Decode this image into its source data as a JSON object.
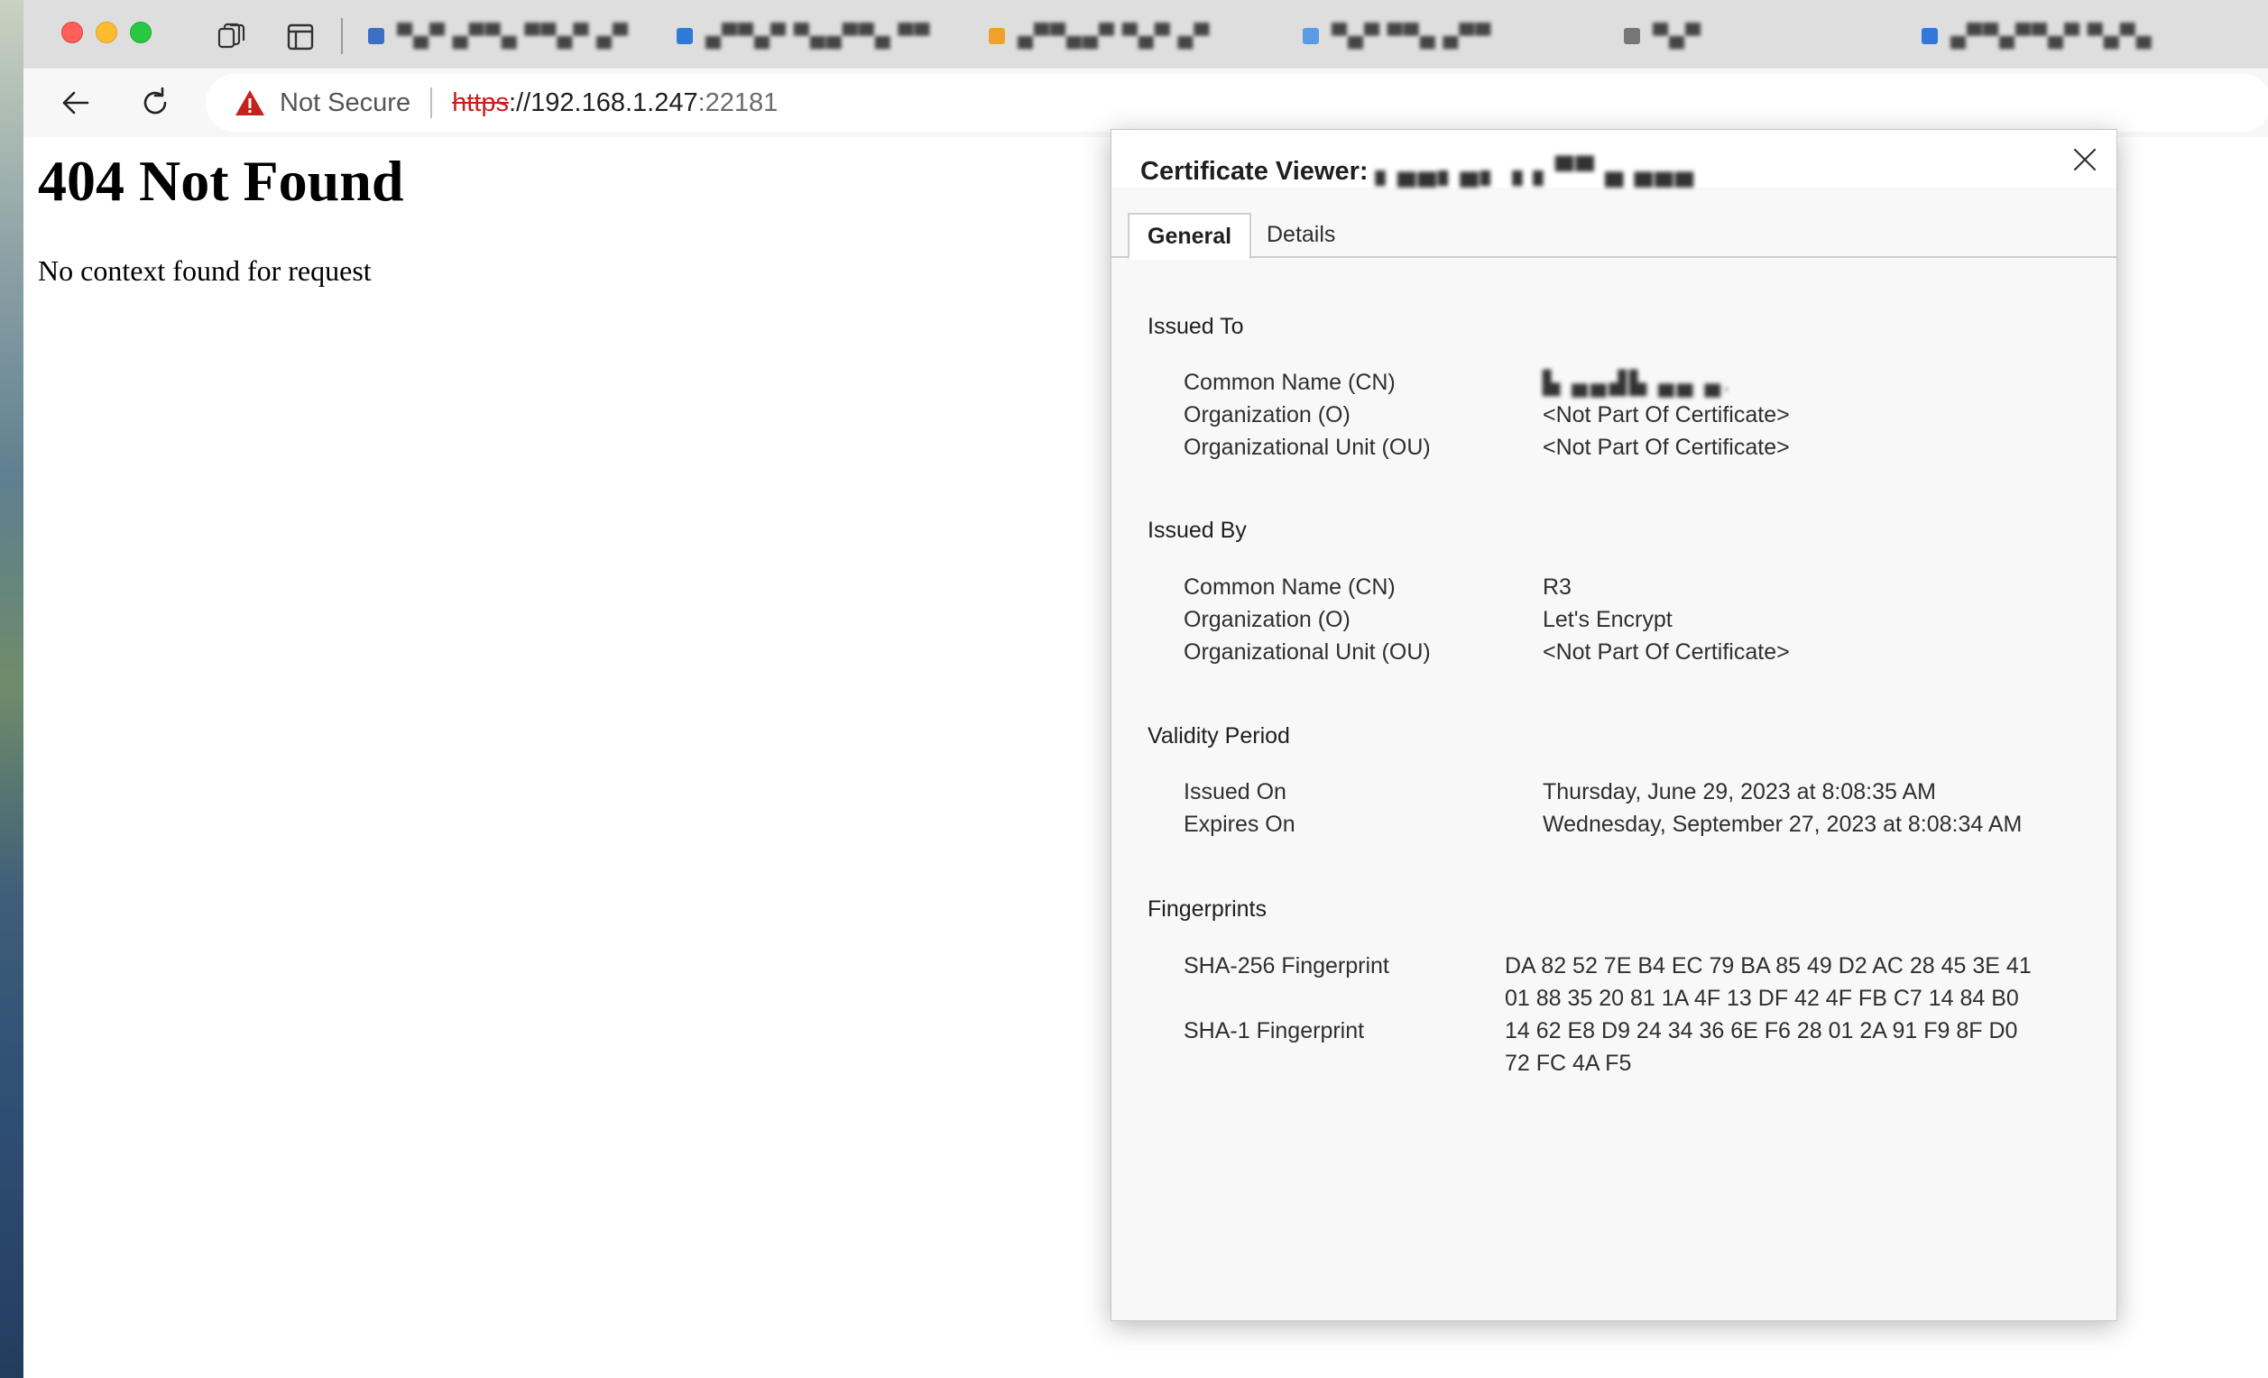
{
  "browser": {
    "tabs": [
      {
        "title": "▀▄▀ ▄▀▀▄ ▀▀▄▀ ▄▀",
        "favicon_color": "#3b6fc4"
      },
      {
        "title": "▄▀▀▄▀ ▀▄▄▀▀▄ ▀▀",
        "favicon_color": "#2f7ad8"
      },
      {
        "title": "▄▀▀▄▄▀ ▀▄▀ ▄▀",
        "favicon_color": "#f0a12b"
      },
      {
        "title": "▀▄▀ ▀▀▄ ▄▀▀",
        "favicon_color": "#5a9be6"
      },
      {
        "title": "▀▄▀",
        "favicon_color": "#777777"
      },
      {
        "title": "▄▀▀▄▀▀▄▀ ▀▄▀▄",
        "favicon_color": "#2f7ad8"
      }
    ],
    "address": {
      "security_label": "Not Secure",
      "scheme": "https",
      "separator": "://",
      "host": "192.168.1.247",
      "port": ":22181"
    }
  },
  "page": {
    "heading": "404 Not Found",
    "message": "No context found for request"
  },
  "certificate_viewer": {
    "title": "Certificate Viewer:",
    "subject": "▖▄▄▖▄▖▗ ▖▀▀ ▄ ▄▄▄",
    "tabs": [
      "General",
      "Details"
    ],
    "issued_to": {
      "heading": "Issued To",
      "rows": [
        {
          "label": "Common Name (CN)",
          "value": "▙ ▄▄▟▙ ▄▄ ▄."
        },
        {
          "label": "Organization (O)",
          "value": "<Not Part Of Certificate>"
        },
        {
          "label": "Organizational Unit (OU)",
          "value": "<Not Part Of Certificate>"
        }
      ]
    },
    "issued_by": {
      "heading": "Issued By",
      "rows": [
        {
          "label": "Common Name (CN)",
          "value": "R3"
        },
        {
          "label": "Organization (O)",
          "value": "Let's Encrypt"
        },
        {
          "label": "Organizational Unit (OU)",
          "value": "<Not Part Of Certificate>"
        }
      ]
    },
    "validity": {
      "heading": "Validity Period",
      "rows": [
        {
          "label": "Issued On",
          "value": "Thursday, June 29, 2023 at 8:08:35 AM"
        },
        {
          "label": "Expires On",
          "value": "Wednesday, September 27, 2023 at 8:08:34 AM"
        }
      ]
    },
    "fingerprints": {
      "heading": "Fingerprints",
      "sha256_label": "SHA-256 Fingerprint",
      "sha256_line1": "DA 82 52 7E B4 EC 79 BA 85 49 D2 AC 28 45 3E 41",
      "sha256_line2": "01 88 35 20 81 1A 4F 13 DF 42 4F FB C7 14 84 B0",
      "sha1_label": "SHA-1 Fingerprint",
      "sha1_line1": "14 62 E8 D9 24 34 36 6E F6 28 01 2A 91 F9 8F D0",
      "sha1_line2": "72 FC 4A F5"
    }
  },
  "colors": {
    "insecure_red": "#c5221f",
    "tab_strip": "#dedede",
    "dialog_bg": "#f8f8f8"
  },
  "icons": [
    "tab-actions-icon",
    "vertical-tabs-icon",
    "back-arrow-icon",
    "reload-icon",
    "warning-triangle-icon",
    "close-icon"
  ]
}
